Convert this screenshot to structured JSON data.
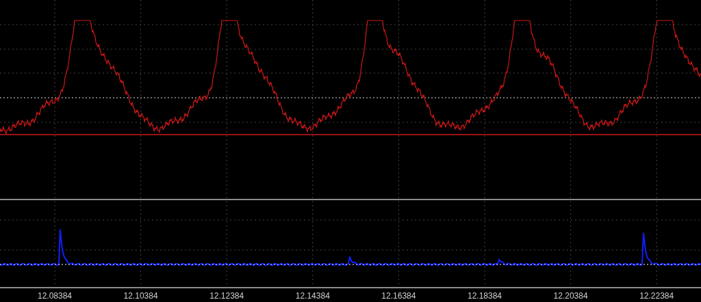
{
  "time_axis": {
    "tick_labels": [
      "12.08384",
      "12.10384",
      "12.12384",
      "12.14384",
      "12.16384",
      "12.18384",
      "12.20384",
      "12.22384"
    ]
  }
}
